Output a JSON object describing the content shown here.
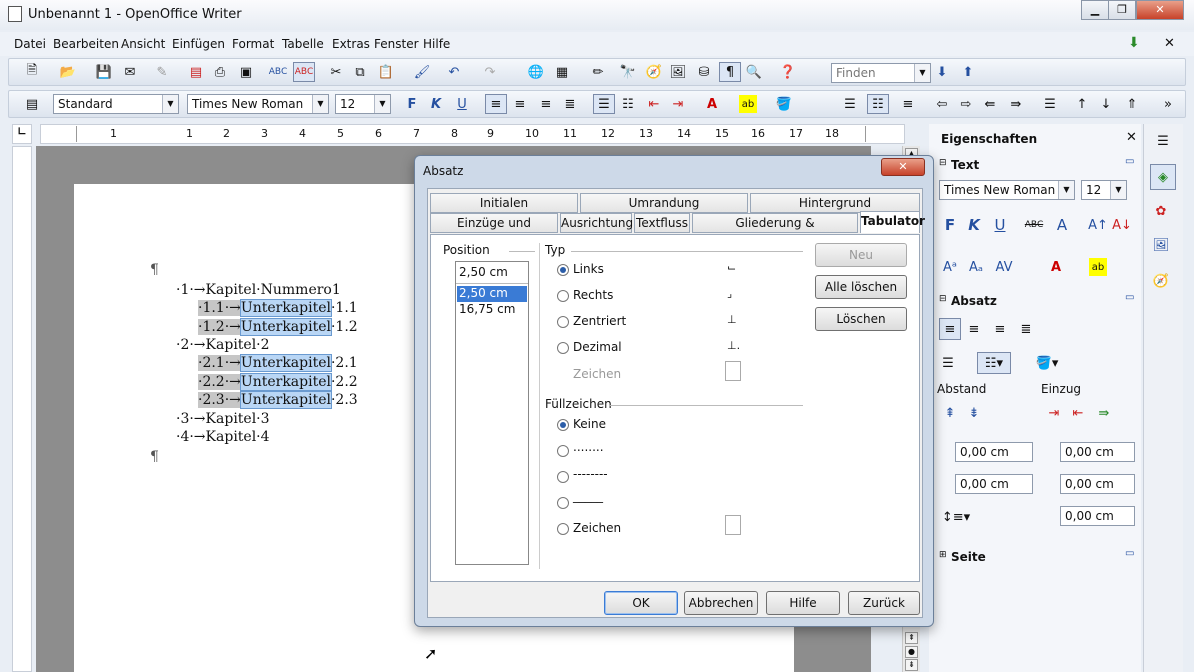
{
  "window": {
    "title": "Unbenannt 1 - OpenOffice Writer"
  },
  "menu": [
    "Datei",
    "Bearbeiten",
    "Ansicht",
    "Einfügen",
    "Format",
    "Tabelle",
    "Extras",
    "Fenster",
    "Hilfe"
  ],
  "toolbar": {
    "find_placeholder": "Finden",
    "style": "Standard",
    "font": "Times New Roman",
    "size": "12"
  },
  "ruler": {
    "numbers": [
      "1",
      "1",
      "2",
      "3",
      "4",
      "5",
      "6",
      "7",
      "8",
      "9",
      "10",
      "11",
      "12",
      "13",
      "14",
      "15",
      "16",
      "17",
      "18"
    ]
  },
  "document": {
    "lines": [
      {
        "num": "·1·→",
        "text": "Kapitel·Nummero1",
        "level": 0
      },
      {
        "num": "·1.1·→",
        "text": "Unterkapitel",
        "suffix": "·1.1",
        "level": 1
      },
      {
        "num": "·1.2·→",
        "text": "Unterkapitel",
        "suffix": "·1.2",
        "level": 1
      },
      {
        "num": "·2·→",
        "text": "Kapitel·2",
        "level": 0
      },
      {
        "num": "·2.1·→",
        "text": "Unterkapitel",
        "suffix": "·2.1",
        "level": 1
      },
      {
        "num": "·2.2·→",
        "text": "Unterkapitel",
        "suffix": "·2.2",
        "level": 1
      },
      {
        "num": "·2.3·→",
        "text": "Unterkapitel",
        "suffix": "·2.3",
        "level": 1
      },
      {
        "num": "·3·→",
        "text": "Kapitel·3",
        "level": 0
      },
      {
        "num": "·4·→",
        "text": "Kapitel·4",
        "level": 0
      }
    ],
    "pilcrow": "¶"
  },
  "sidebar": {
    "title": "Eigenschaften",
    "text_section": "Text",
    "font": "Times New Roman",
    "size": "12",
    "para_section": "Absatz",
    "abstand": "Abstand",
    "einzug": "Einzug",
    "spin_values": [
      "0,00 cm",
      "0,00 cm",
      "0,00 cm",
      "0,00 cm",
      "0,00 cm"
    ],
    "seite_section": "Seite"
  },
  "dialog": {
    "title": "Absatz",
    "tabs_row1": [
      "Initialen",
      "Umrandung",
      "Hintergrund"
    ],
    "tabs_row2": [
      "Einzüge und Abstände",
      "Ausrichtung",
      "Textfluss",
      "Gliederung & Nummerierung",
      "Tabulator"
    ],
    "position_label": "Position",
    "position_value": "2,50 cm",
    "positions": [
      "2,50 cm",
      "16,75 cm"
    ],
    "typ_label": "Typ",
    "typ_options": [
      "Links",
      "Rechts",
      "Zentriert",
      "Dezimal"
    ],
    "zeichen_label": "Zeichen",
    "fill_label": "Füllzeichen",
    "fill_options": [
      "Keine",
      "........",
      "--------",
      "_____",
      "Zeichen"
    ],
    "btn_neu": "Neu",
    "btn_alle": "Alle löschen",
    "btn_loeschen": "Löschen",
    "btn_ok": "OK",
    "btn_abbrechen": "Abbrechen",
    "btn_hilfe": "Hilfe",
    "btn_zurueck": "Zurück"
  }
}
